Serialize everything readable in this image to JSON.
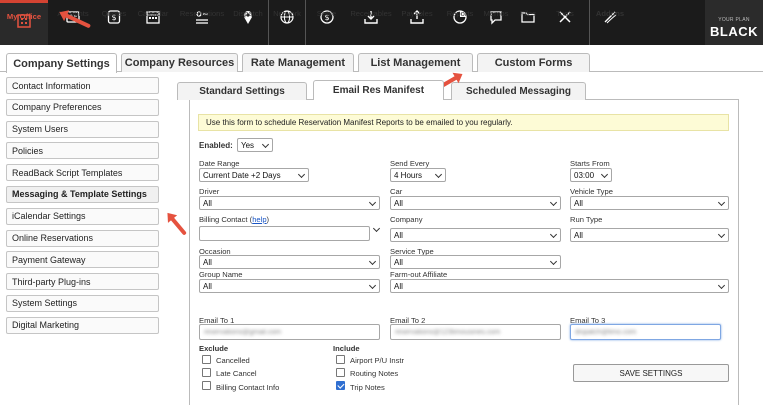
{
  "nav": {
    "items": [
      {
        "label": "My Office",
        "icon": "building-icon"
      },
      {
        "label": "Accounts",
        "icon": "accounts-icon"
      },
      {
        "label": "Quotes",
        "icon": "quotes-icon"
      },
      {
        "label": "Calendar",
        "icon": "calendar-icon"
      },
      {
        "label": "Reservations",
        "icon": "reservations-icon"
      },
      {
        "label": "Dispatch",
        "icon": "dispatch-icon"
      },
      {
        "label": "Network",
        "icon": "globe-icon"
      },
      {
        "label": "Settle",
        "icon": "settle-icon"
      },
      {
        "label": "Receivables",
        "icon": "download-icon"
      },
      {
        "label": "Payables",
        "icon": "upload-icon"
      },
      {
        "label": "Reports",
        "icon": "pie-chart-icon"
      },
      {
        "label": "Memos",
        "icon": "memos-icon"
      },
      {
        "label": "Files",
        "icon": "folder-icon"
      },
      {
        "label": "Tools",
        "icon": "tools-icon"
      },
      {
        "label": "Addons",
        "icon": "addons-icon"
      }
    ],
    "plan_small": "YOUR PLAN",
    "plan_big": "BLACK",
    "accent": "#e5523f"
  },
  "main_tabs": [
    "Company Settings",
    "Company Resources",
    "Rate Management",
    "List Management",
    "Custom Forms"
  ],
  "sidebar": [
    "Contact Information",
    "Company Preferences",
    "System Users",
    "Policies",
    "ReadBack Script Templates",
    "Messaging & Template Settings",
    "iCalendar Settings",
    "Online Reservations",
    "Payment Gateway",
    "Third-party Plug-ins",
    "System Settings",
    "Digital Marketing"
  ],
  "sub_tabs": [
    "Standard Settings",
    "Email Res Manifest",
    "Scheduled Messaging"
  ],
  "form": {
    "notice": "Use this form to schedule Reservation Manifest Reports to be emailed to you regularly.",
    "enabled_label": "Enabled:",
    "enabled_value": "Yes",
    "date_range_label": "Date Range",
    "date_range_value": "Current Date +2 Days",
    "send_every_label": "Send Every",
    "send_every_value": "4 Hours",
    "starts_from_label": "Starts From",
    "starts_from_value": "03:00",
    "driver_label": "Driver",
    "driver_value": "All",
    "car_label": "Car",
    "car_value": "All",
    "vehicle_type_label": "Vehicle Type",
    "vehicle_type_value": "All",
    "billing_contact_label": "Billing Contact (",
    "billing_contact_help": "help",
    "billing_contact_close": ")",
    "company_label": "Company",
    "company_value": "All",
    "run_type_label": "Run Type",
    "run_type_value": "All",
    "occasion_label": "Occasion",
    "occasion_value": "All",
    "service_type_label": "Service Type",
    "service_type_value": "All",
    "group_name_label": "Group Name",
    "group_name_value": "All",
    "farm_out_label": "Farm-out Affiliate",
    "farm_out_value": "All",
    "email1_label": "Email To 1",
    "email1_value": "reservations@gmail.com",
    "email2_label": "Email To 2",
    "email2_value": "reservations@123limousines.com",
    "email3_label": "Email To 3",
    "email3_value": "dispatch@limo.com",
    "exclude_label": "Exclude",
    "include_label": "Include",
    "exclude_items": [
      "Cancelled",
      "Late Cancel",
      "Billing Contact Info"
    ],
    "include_items": [
      "Airport P/U Instr",
      "Routing Notes",
      "Trip Notes"
    ],
    "include_checked": [
      false,
      false,
      true
    ],
    "save_label": "SAVE SETTINGS"
  }
}
